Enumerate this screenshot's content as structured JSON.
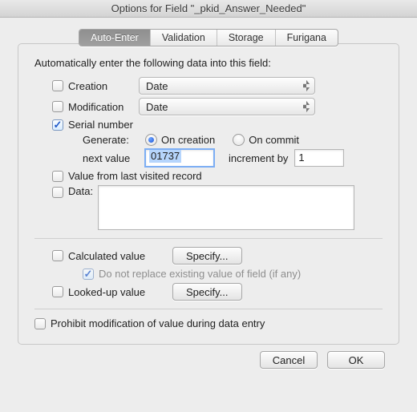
{
  "title": "Options for Field \"_pkid_Answer_Needed\"",
  "tabs": [
    "Auto-Enter",
    "Validation",
    "Storage",
    "Furigana"
  ],
  "intro": "Automatically enter the following data into this field:",
  "creation": {
    "label": "Creation",
    "select": "Date"
  },
  "modification": {
    "label": "Modification",
    "select": "Date"
  },
  "serial": {
    "label": "Serial number",
    "generateLabel": "Generate:",
    "onCreation": "On creation",
    "onCommit": "On commit",
    "nextValueLabel": "next value",
    "nextValue": "01737",
    "incrementLabel": "increment by",
    "increment": "1"
  },
  "valueFromLast": "Value from last visited record",
  "dataLabel": "Data:",
  "calculated": {
    "label": "Calculated value",
    "specify": "Specify...",
    "doNotReplace": "Do not replace existing value of field (if any)"
  },
  "lookedUp": {
    "label": "Looked-up value",
    "specify": "Specify..."
  },
  "prohibit": "Prohibit modification of value during data entry",
  "buttons": {
    "cancel": "Cancel",
    "ok": "OK"
  }
}
